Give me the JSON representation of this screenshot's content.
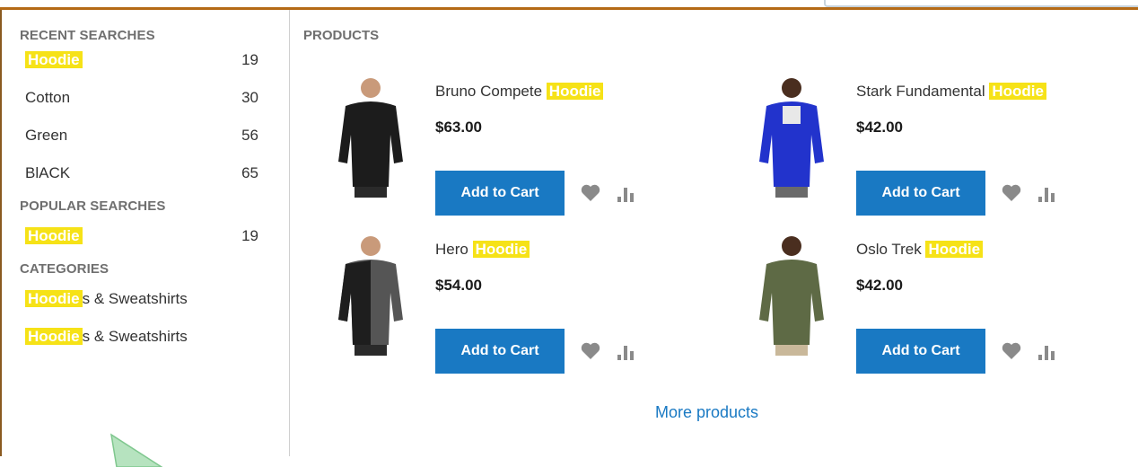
{
  "recent_searches": {
    "title": "RECENT SEARCHES",
    "items": [
      {
        "label": "Hoodie",
        "count": "19"
      },
      {
        "label": "Cotton",
        "count": "30"
      },
      {
        "label": "Green",
        "count": "56"
      },
      {
        "label": "BlACK",
        "count": "65"
      }
    ]
  },
  "popular_searches": {
    "title": "POPULAR SEARCHES",
    "items": [
      {
        "label": "Hoodie",
        "count": "19"
      }
    ]
  },
  "categories": {
    "title": "CATEGORIES",
    "items": [
      {
        "highlight": "Hoodie",
        "rest": "s & Sweatshirts"
      },
      {
        "highlight": "Hoodie",
        "rest": "s & Sweatshirts"
      }
    ]
  },
  "products": {
    "title": "PRODUCTS",
    "highlight_color": "#f6e217",
    "button_color": "#1979c3",
    "items": [
      {
        "name_prefix": "Bruno Compete ",
        "name_highlight": "Hoodie",
        "price": "$63.00",
        "add_to_cart": "Add to Cart",
        "jacket_color": "#1c1c1c"
      },
      {
        "name_prefix": "Stark Fundamental ",
        "name_highlight": "Hoodie",
        "price": "$42.00",
        "add_to_cart": "Add to Cart",
        "jacket_color": "#2233cc"
      },
      {
        "name_prefix": "Hero ",
        "name_highlight": "Hoodie",
        "price": "$54.00",
        "add_to_cart": "Add to Cart",
        "jacket_color": "#555555"
      },
      {
        "name_prefix": "Oslo Trek ",
        "name_highlight": "Hoodie",
        "price": "$42.00",
        "add_to_cart": "Add to Cart",
        "jacket_color": "#5e6a45"
      }
    ],
    "more_link": "More products"
  }
}
